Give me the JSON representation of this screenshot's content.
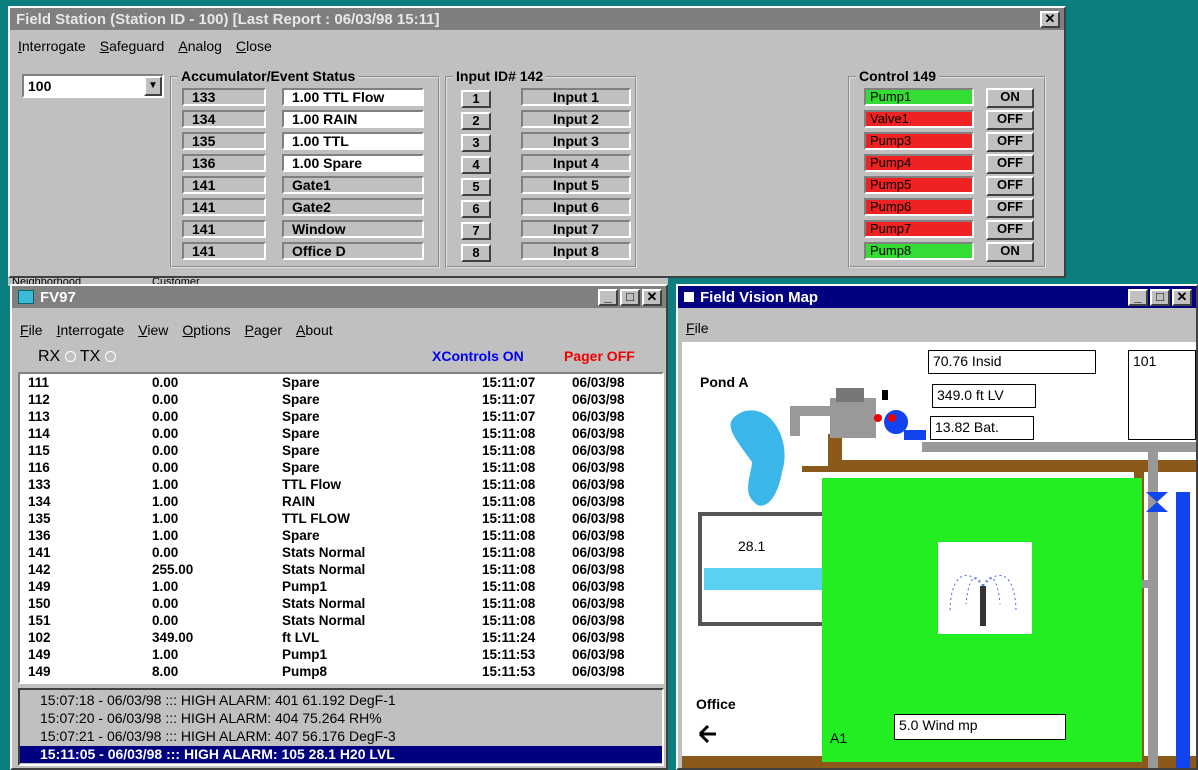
{
  "field_station": {
    "title": "Field Station (Station ID - 100) [Last Report : 06/03/98  15:11]",
    "menu": [
      "Interrogate",
      "Safeguard",
      "Analog",
      "Close"
    ],
    "station_select": "100",
    "accumulator": {
      "label": "Accumulator/Event Status",
      "rows": [
        {
          "id": "133",
          "value": "1.00 TTL Flow",
          "style": "white"
        },
        {
          "id": "134",
          "value": "1.00 RAIN",
          "style": "white"
        },
        {
          "id": "135",
          "value": "1.00 TTL",
          "style": "white"
        },
        {
          "id": "136",
          "value": "1.00 Spare",
          "style": "white"
        },
        {
          "id": "141",
          "value": "Gate1",
          "style": "grey"
        },
        {
          "id": "141",
          "value": "Gate2",
          "style": "grey"
        },
        {
          "id": "141",
          "value": "Window",
          "style": "grey"
        },
        {
          "id": "141",
          "value": "Office D",
          "style": "grey"
        }
      ]
    },
    "inputs": {
      "label": "Input ID# 142",
      "rows": [
        {
          "num": "1",
          "name": "Input 1"
        },
        {
          "num": "2",
          "name": "Input 2"
        },
        {
          "num": "3",
          "name": "Input 3"
        },
        {
          "num": "4",
          "name": "Input 4"
        },
        {
          "num": "5",
          "name": "Input 5"
        },
        {
          "num": "6",
          "name": "Input 6"
        },
        {
          "num": "7",
          "name": "Input 7"
        },
        {
          "num": "8",
          "name": "Input 8"
        }
      ]
    },
    "control": {
      "label": "Control  149",
      "rows": [
        {
          "name": "Pump1",
          "state": "ON",
          "color": "#33dd33"
        },
        {
          "name": "Valve1",
          "state": "OFF",
          "color": "#ee2222"
        },
        {
          "name": "Pump3",
          "state": "OFF",
          "color": "#ee2222"
        },
        {
          "name": "Pump4",
          "state": "OFF",
          "color": "#ee2222"
        },
        {
          "name": "Pump5",
          "state": "OFF",
          "color": "#ee2222"
        },
        {
          "name": "Pump6",
          "state": "OFF",
          "color": "#ee2222"
        },
        {
          "name": "Pump7",
          "state": "OFF",
          "color": "#ee2222"
        },
        {
          "name": "Pump8",
          "state": "ON",
          "color": "#33dd33"
        }
      ]
    }
  },
  "background_tabs": [
    "Neighborhood",
    "Customer"
  ],
  "fv97": {
    "title": "FV97",
    "menu": [
      "File",
      "Interrogate",
      "View",
      "Options",
      "Pager",
      "About"
    ],
    "rx_label": "RX",
    "tx_label": "TX",
    "xcontrols": "XControls ON",
    "pager": "Pager OFF",
    "rows": [
      [
        "111",
        "0.00",
        "Spare",
        "15:11:07",
        "06/03/98"
      ],
      [
        "112",
        "0.00",
        "Spare",
        "15:11:07",
        "06/03/98"
      ],
      [
        "113",
        "0.00",
        "Spare",
        "15:11:07",
        "06/03/98"
      ],
      [
        "114",
        "0.00",
        "Spare",
        "15:11:08",
        "06/03/98"
      ],
      [
        "115",
        "0.00",
        "Spare",
        "15:11:08",
        "06/03/98"
      ],
      [
        "116",
        "0.00",
        "Spare",
        "15:11:08",
        "06/03/98"
      ],
      [
        "133",
        "1.00",
        "TTL Flow",
        "15:11:08",
        "06/03/98"
      ],
      [
        "134",
        "1.00",
        "RAIN",
        "15:11:08",
        "06/03/98"
      ],
      [
        "135",
        "1.00",
        "TTL FLOW",
        "15:11:08",
        "06/03/98"
      ],
      [
        "136",
        "1.00",
        "Spare",
        "15:11:08",
        "06/03/98"
      ],
      [
        "141",
        "0.00",
        "Stats Normal",
        "15:11:08",
        "06/03/98"
      ],
      [
        "142",
        "255.00",
        "Stats Normal",
        "15:11:08",
        "06/03/98"
      ],
      [
        "149",
        "1.00",
        "Pump1",
        "15:11:08",
        "06/03/98"
      ],
      [
        "150",
        "0.00",
        "Stats Normal",
        "15:11:08",
        "06/03/98"
      ],
      [
        "151",
        "0.00",
        "Stats Normal",
        "15:11:08",
        "06/03/98"
      ],
      [
        "102",
        "349.00",
        "ft LVL",
        "15:11:24",
        "06/03/98"
      ],
      [
        "149",
        "1.00",
        "Pump1",
        "15:11:53",
        "06/03/98"
      ],
      [
        "149",
        "8.00",
        "Pump8",
        "15:11:53",
        "06/03/98"
      ]
    ],
    "alarms": [
      "15:07:18 - 06/03/98 ::: HIGH ALARM:  401   61.192  DegF-1",
      "15:07:20 - 06/03/98 ::: HIGH ALARM:  404   75.264  RH%",
      "15:07:21 - 06/03/98 ::: HIGH ALARM:  407   56.176  DegF-3",
      "15:11:05 - 06/03/98 ::: HIGH ALARM:  105   28.1  H20 LVL"
    ]
  },
  "map": {
    "title": "Field Vision Map",
    "menu": [
      "File"
    ],
    "pond_label": "Pond A",
    "readout_1": "70.76 Insid",
    "readout_2": "349.0 ft LV",
    "readout_3": "13.82 Bat.",
    "station_id": "101",
    "tank_level": "28.1",
    "office_label": "Office",
    "field_label": "A1",
    "wind_readout": "5.0 Wind mp",
    "colors": {
      "field": "#22ee22",
      "pipe": "#8b5a1a",
      "water": "#5bd0f0",
      "valve": "#1144ee"
    }
  }
}
